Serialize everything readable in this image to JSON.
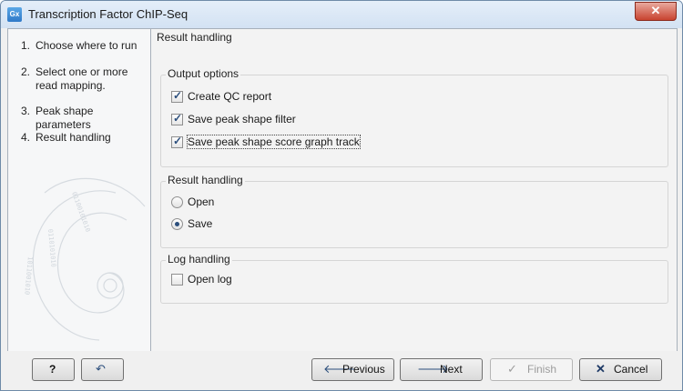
{
  "window": {
    "title": "Transcription Factor ChIP-Seq",
    "app_icon": "Gx"
  },
  "steps": [
    {
      "num": "1.",
      "label": "Choose where to run"
    },
    {
      "num": "2.",
      "label": "Select one or more read mapping."
    },
    {
      "num": "3.",
      "label": "Peak shape parameters"
    },
    {
      "num": "4.",
      "label": "Result handling"
    }
  ],
  "main": {
    "header": "Result handling",
    "output_options": {
      "title": "Output options",
      "items": [
        {
          "label": "Create QC report",
          "checked": true
        },
        {
          "label": "Save peak shape filter",
          "checked": true
        },
        {
          "label": "Save peak shape score graph track",
          "checked": true
        }
      ]
    },
    "result_handling": {
      "title": "Result handling",
      "options": [
        {
          "label": "Open",
          "selected": false
        },
        {
          "label": "Save",
          "selected": true
        }
      ]
    },
    "log_handling": {
      "title": "Log handling",
      "items": [
        {
          "label": "Open log",
          "checked": false
        }
      ]
    }
  },
  "footer": {
    "help_label": "?",
    "previous_label": "Previous",
    "next_label": "Next",
    "finish_label": "Finish",
    "cancel_label": "Cancel"
  },
  "colors": {
    "accent": "#2b4e7c",
    "window_border": "#6e8aa8",
    "close_red": "#c8432f"
  }
}
